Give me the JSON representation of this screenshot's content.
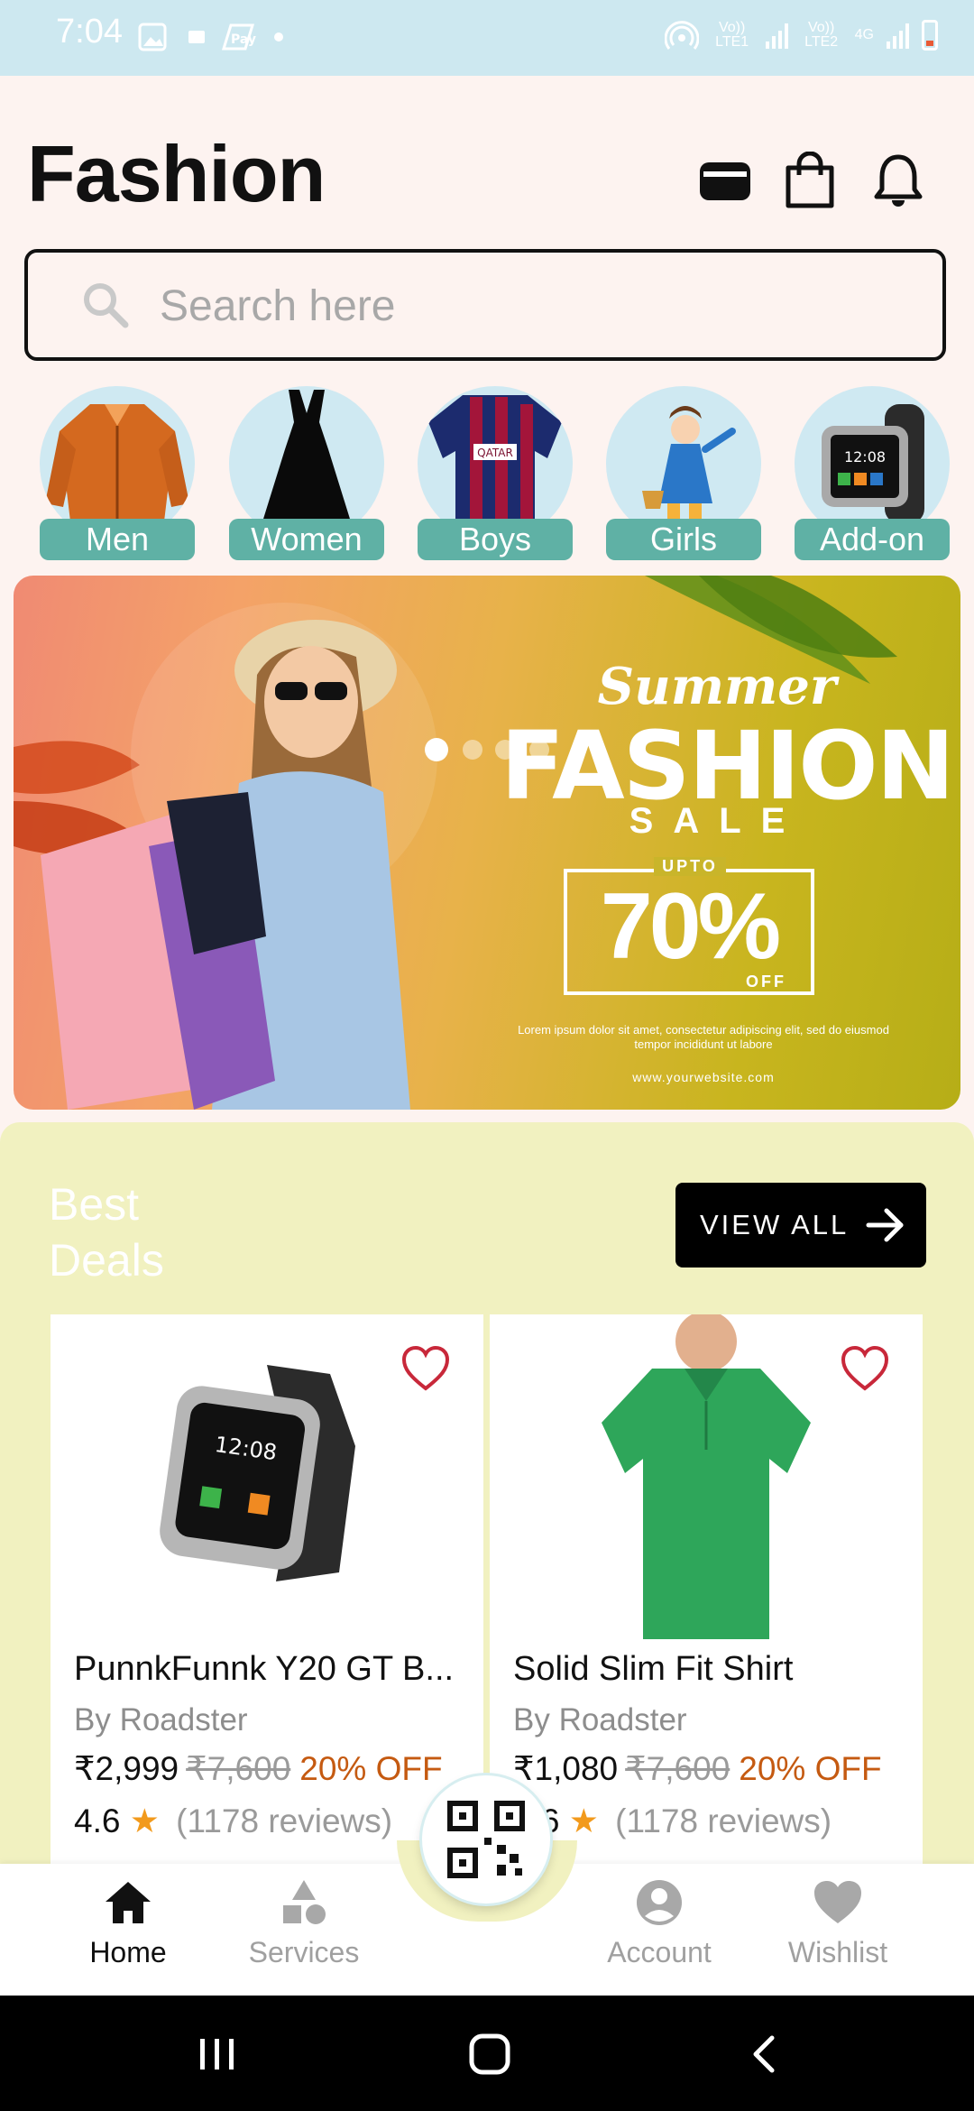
{
  "status_bar": {
    "time": "7:04",
    "network_1": "Vo)) LTE1",
    "network_2": "Vo)) LTE2",
    "network_type": "4G"
  },
  "header": {
    "title": "Fashion",
    "icons": [
      "wallet-icon",
      "shopping-bag-icon",
      "bell-icon"
    ]
  },
  "search": {
    "placeholder": "Search here"
  },
  "categories": [
    {
      "label": "Men"
    },
    {
      "label": "Women"
    },
    {
      "label": "Boys"
    },
    {
      "label": "Girls"
    },
    {
      "label": "Add-on"
    }
  ],
  "banner": {
    "line1": "Summer",
    "line2": "FASHION",
    "line3": "SALE",
    "upto": "UPTO",
    "percent": "70%",
    "off": "OFF",
    "lorem": "Lorem ipsum dolor sit amet, consectetur adipiscing elit, sed do eiusmod tempor incididunt ut labore",
    "website": "www.yourwebsite.com",
    "slide_count": 4,
    "active_slide": 1
  },
  "deals": {
    "title": "Best Deals",
    "view_all": "VIEW ALL",
    "products": [
      {
        "title": "PunnkFunnk Y20 GT B...",
        "brand": "By Roadster",
        "price": "₹2,999",
        "old_price": "₹7,600",
        "discount": "20% OFF",
        "rating": "4.6",
        "reviews": "(1178 reviews)"
      },
      {
        "title": "Solid Slim Fit Shirt",
        "brand": "By Roadster",
        "price": "₹1,080",
        "old_price": "₹7,600",
        "discount": "20% OFF",
        "rating": "4.6",
        "reviews": "(1178 reviews)"
      }
    ]
  },
  "bottom_nav": {
    "items": [
      {
        "label": "Home",
        "active": true
      },
      {
        "label": "Services",
        "active": false
      },
      {
        "label": "Account",
        "active": false
      },
      {
        "label": "Wishlist",
        "active": false
      }
    ]
  },
  "colors": {
    "status_bar": "#cde8f0",
    "category_label": "#5fb1a5",
    "deals_bg": "#f1f1c0",
    "discount": "#c55a11",
    "star": "#f29a1c"
  }
}
